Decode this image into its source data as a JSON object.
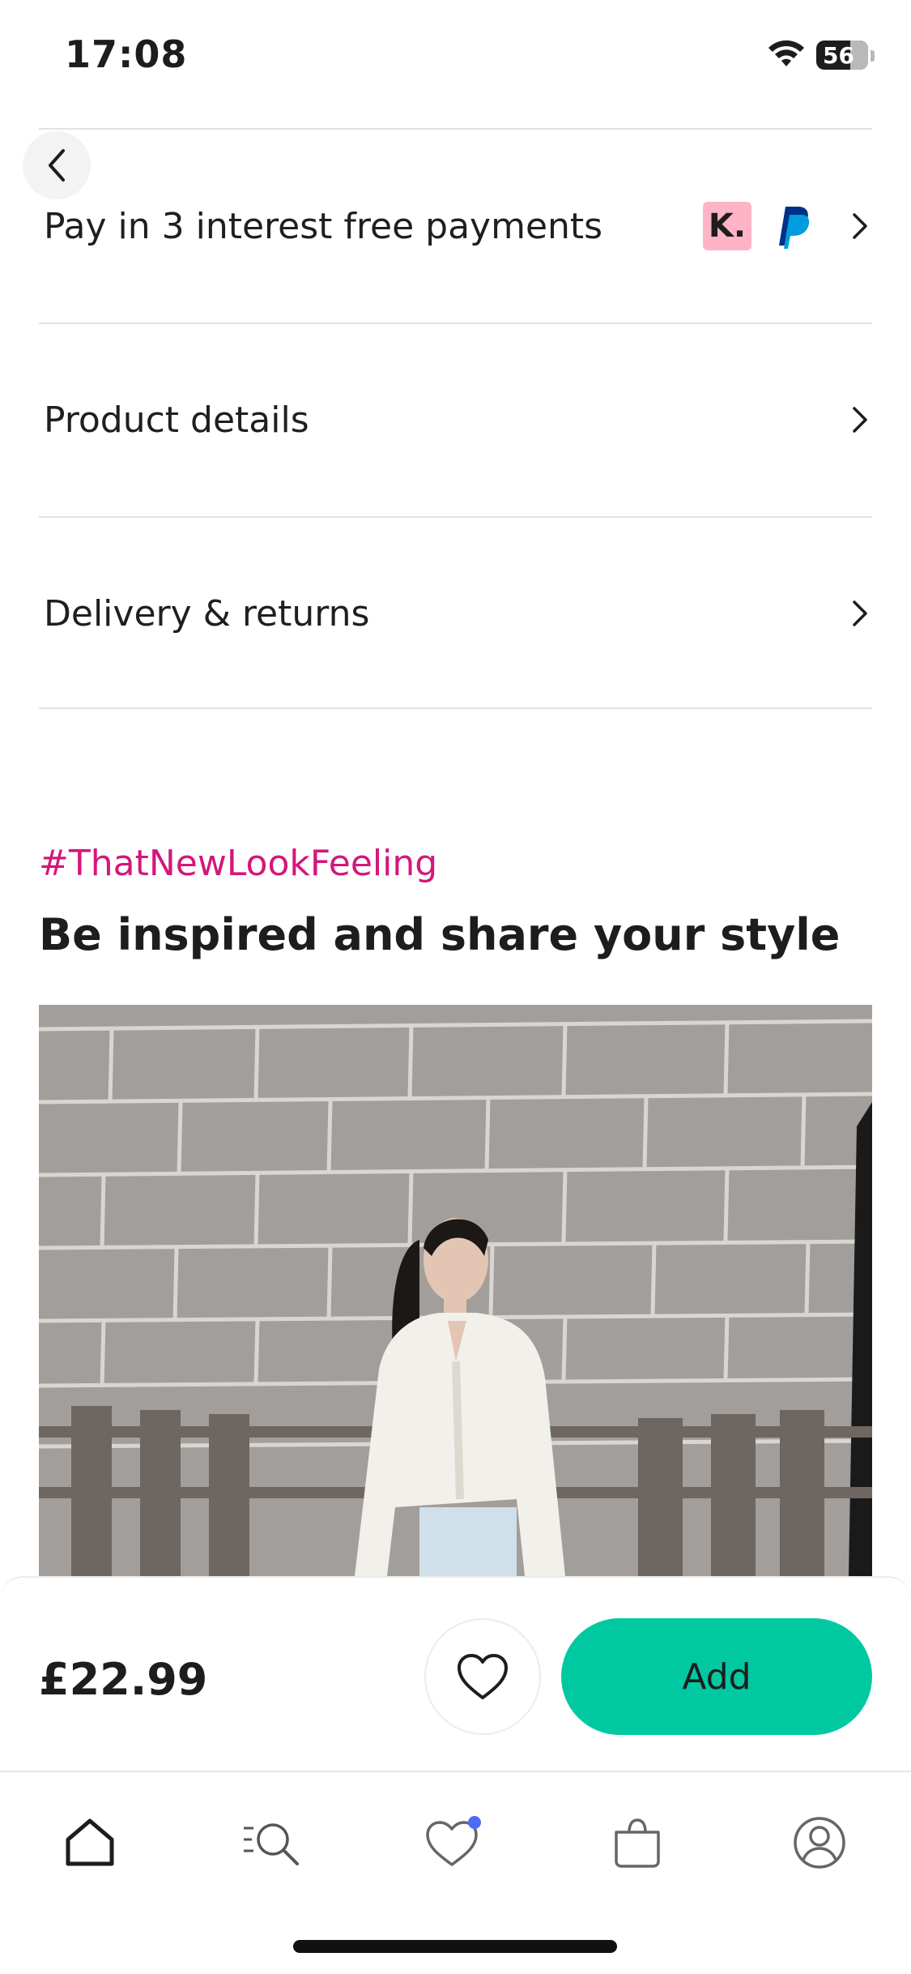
{
  "status_bar": {
    "time": "17:08",
    "battery": "56"
  },
  "rows": [
    {
      "label": "Pay in 3 interest free payments"
    },
    {
      "label": "Product details"
    },
    {
      "label": "Delivery & returns"
    }
  ],
  "payment_icons": {
    "klarna": "K.",
    "paypal": "paypal-icon"
  },
  "inspiration": {
    "hashtag": "#ThatNewLookFeeling",
    "title": "Be inspired and share your style"
  },
  "buy_bar": {
    "price": "£22.99",
    "add_label": "Add"
  },
  "colors": {
    "accent": "#00c9a2",
    "hashtag": "#d4177a",
    "badge": "#4a6cf7"
  },
  "tab_bar": {
    "items": [
      "home-icon",
      "search-icon",
      "wishlist-icon",
      "bag-icon",
      "account-icon"
    ]
  }
}
